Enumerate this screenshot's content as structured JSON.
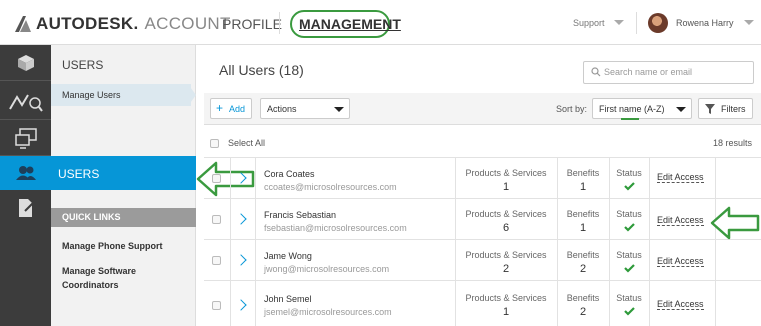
{
  "header": {
    "brand": "AUTODESK.",
    "brand_sub": "ACCOUNT",
    "nav_profile": "PROFILE",
    "nav_management": "MANAGEMENT",
    "support": "Support",
    "user_name": "Rowena Harry"
  },
  "sidebar": {
    "section_title": "USERS",
    "manage_users": "Manage Users",
    "active_users": "USERS",
    "quick_links": "QUICK LINKS",
    "links": [
      "Manage Phone Support",
      "Manage Software",
      "Coordinators"
    ],
    "icons": [
      "cube-icon",
      "chart-icon",
      "devices-icon",
      "users-icon",
      "document-icon"
    ]
  },
  "main": {
    "title": "All Users (18)",
    "search_placeholder": "Search name or email",
    "add_label": "Add",
    "actions_label": "Actions",
    "sort_by_label": "Sort by:",
    "sort_value": "First name (A-Z)",
    "filters_label": "Filters",
    "select_all": "Select All",
    "results": "18 results",
    "col_products": "Products & Services",
    "col_benefits": "Benefits",
    "col_status": "Status",
    "edit_access": "Edit Access",
    "rows": [
      {
        "name": "Cora Coates",
        "email": "ccoates@microsolresources.com",
        "products": "1",
        "benefits": "1"
      },
      {
        "name": "Francis Sebastian",
        "email": "fsebastian@microsolresources.com",
        "products": "6",
        "benefits": "1"
      },
      {
        "name": "Jame Wong",
        "email": "jwong@microsolresources.com",
        "products": "2",
        "benefits": "2"
      },
      {
        "name": "John Semel",
        "email": "jsemel@microsolresources.com",
        "products": "1",
        "benefits": "2"
      }
    ]
  },
  "colors": {
    "accent_blue": "#0696d7",
    "annotation_green": "#3a9a3f",
    "status_check": "#2e9a3a"
  }
}
